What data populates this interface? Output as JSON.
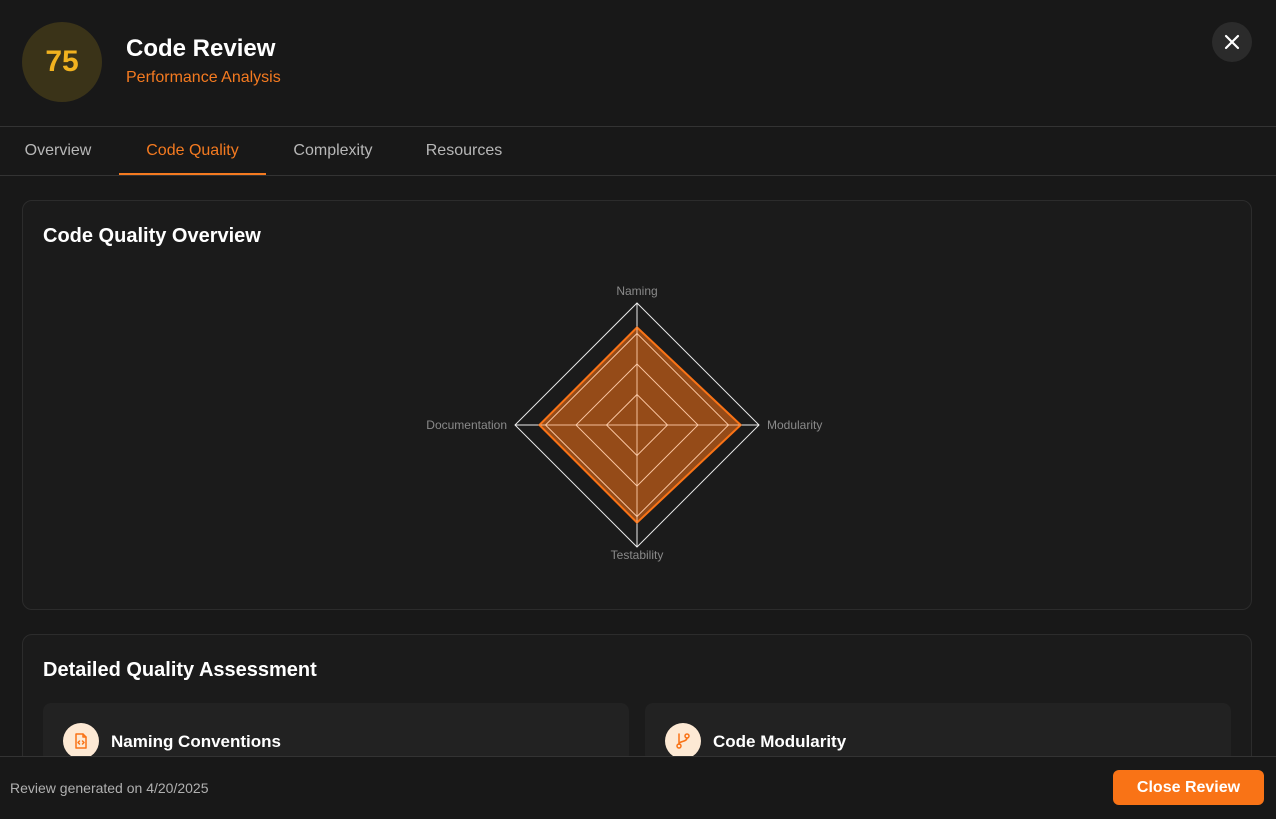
{
  "header": {
    "score": "75",
    "title": "Code Review",
    "subtitle": "Performance Analysis",
    "close_icon": "close-icon"
  },
  "tabs": [
    {
      "label": "Overview",
      "active": false
    },
    {
      "label": "Code Quality",
      "active": true
    },
    {
      "label": "Complexity",
      "active": false
    },
    {
      "label": "Resources",
      "active": false
    }
  ],
  "overview_card": {
    "title": "Code Quality Overview"
  },
  "chart_data": {
    "type": "radar",
    "axes": [
      "Naming",
      "Modularity",
      "Testability",
      "Documentation"
    ],
    "values": [
      80,
      85,
      80,
      80
    ],
    "range": [
      0,
      100
    ],
    "rings": 4,
    "fill_color": "#f97316",
    "stroke_color": "#f97316",
    "grid_color": "#ffffff"
  },
  "assessment": {
    "title": "Detailed Quality Assessment",
    "items": [
      {
        "label": "Naming Conventions",
        "icon": "file-code-icon"
      },
      {
        "label": "Code Modularity",
        "icon": "git-branch-icon"
      }
    ]
  },
  "footer": {
    "generated_text": "Review generated on 4/20/2025",
    "close_label": "Close Review"
  },
  "colors": {
    "accent": "#f97316",
    "score": "#f1b21f",
    "background": "#181818"
  }
}
